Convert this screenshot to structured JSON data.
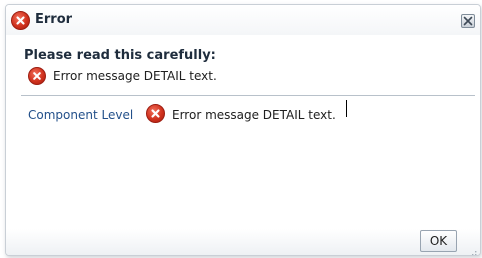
{
  "dialog": {
    "title": "Error",
    "close_icon": "close-icon",
    "title_icon": "error-icon"
  },
  "summary": {
    "heading": "Please read this carefully:",
    "icon": "error-icon",
    "message": "Error message DETAIL text."
  },
  "component": {
    "label": "Component Level",
    "icon": "error-icon",
    "message": "Error message DETAIL text."
  },
  "footer": {
    "ok_label": "OK"
  },
  "colors": {
    "error_red": "#d0321e",
    "label_blue": "#23508a",
    "divider": "#b8c1ca"
  }
}
